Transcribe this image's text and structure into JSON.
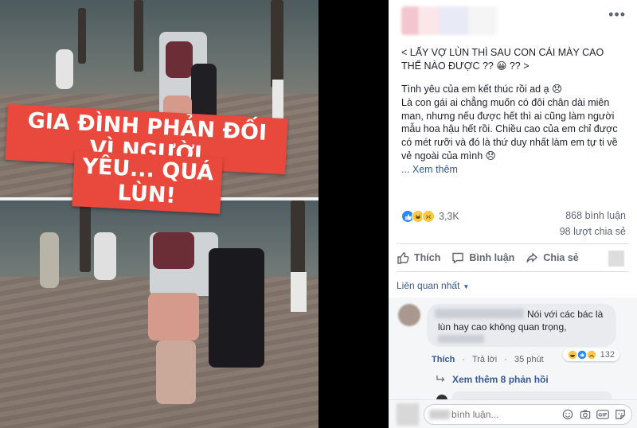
{
  "photo": {
    "caption_line1": "GIA ĐÌNH PHẢN ĐỐI VÌ NGƯỜI",
    "caption_line2": "YÊU... QUÁ LÙN!"
  },
  "post": {
    "title": "< LẤY VỢ LÙN THÌ SAU CON CÁI MÀY CAO THẾ NÀO ĐƯỢC ?? 😀 ?? >",
    "para1": "Tình yêu của em kết thúc rồi ad ạ 😞",
    "para2": "Là con gái ai chẳng muốn có đôi chân dài miên man, nhưng nếu được hết thì ai cũng làm người mẫu hoa hậu hết rồi. Chiều cao của em chỉ được có mét rưỡi và đó là thứ duy nhất làm em tự ti về vẻ ngoài của mình 😞",
    "see_more": "... Xem thêm",
    "more_label": "•••",
    "reaction_count": "3,3K",
    "comments_count": "868 bình luận",
    "shares_count": "98 lượt chia sẻ",
    "actions": {
      "like": "Thích",
      "comment": "Bình luận",
      "share": "Chia sẻ"
    },
    "sort_label": "Liên quan nhất"
  },
  "comment": {
    "text_line1": "Nói với các bác là",
    "text_line2": "lùn hay cao không quan trọng,",
    "react_count": "132",
    "like_label": "Thích",
    "reply_label": "Trả lời",
    "time": "35 phút",
    "view_replies": "Xem thêm 8 phản hồi"
  },
  "composer": {
    "placeholder": "bình luận..."
  },
  "colors": {
    "accent": "#385898",
    "like_blue": "#2d88ff",
    "caption_red": "#e8493c"
  }
}
